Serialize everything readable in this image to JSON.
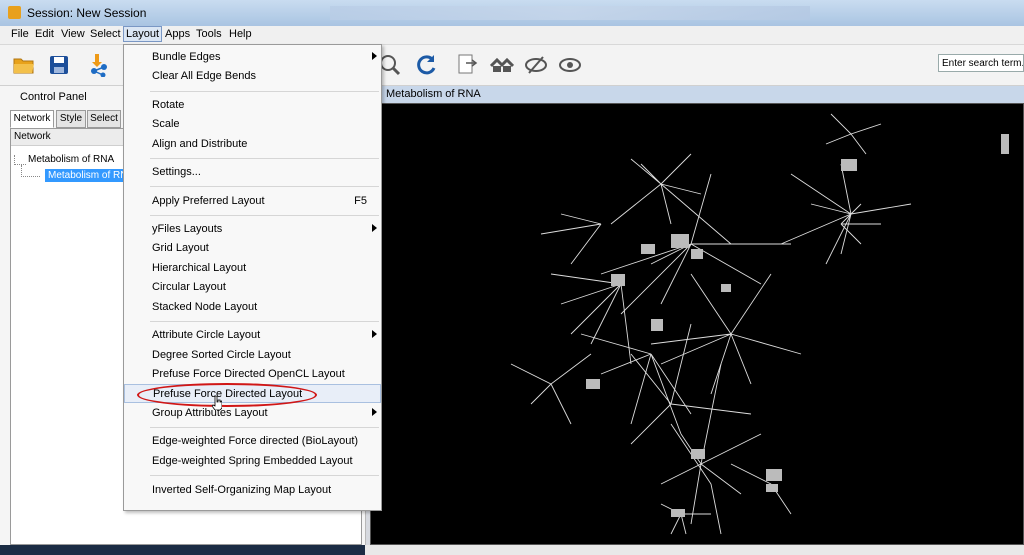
{
  "window": {
    "title": "Session: New Session"
  },
  "menubar": {
    "file": "File",
    "edit": "Edit",
    "view": "View",
    "select": "Select",
    "layout": "Layout",
    "apps": "Apps",
    "tools": "Tools",
    "help": "Help"
  },
  "toolbar": {
    "search_placeholder": "Enter search term...",
    "icons": [
      "open-folder-icon",
      "save-icon",
      "import-network-icon",
      "zoom-selected-icon",
      "refresh-icon",
      "export-image-icon",
      "home-icon",
      "hide-icon",
      "show-icon"
    ]
  },
  "control_panel": {
    "title": "Control Panel",
    "tabs": [
      "Network",
      "Style",
      "Select"
    ],
    "header": "Network",
    "tree": {
      "collection": "Metabolism of RNA",
      "network": "Metabolism of RNA"
    }
  },
  "network_view": {
    "title": "Metabolism of RNA"
  },
  "layout_menu": {
    "items": [
      {
        "label": "Bundle Edges",
        "submenu": true
      },
      {
        "label": "Clear All Edge Bends"
      },
      {
        "label": "Rotate"
      },
      {
        "label": "Scale"
      },
      {
        "label": "Align and Distribute"
      },
      {
        "label": "Settings..."
      },
      {
        "label": "Apply Preferred Layout",
        "accelerator": "F5"
      },
      {
        "label": "yFiles Layouts",
        "submenu": true
      },
      {
        "label": "Grid Layout"
      },
      {
        "label": "Hierarchical Layout"
      },
      {
        "label": "Circular Layout"
      },
      {
        "label": "Stacked Node Layout"
      },
      {
        "label": "Attribute Circle Layout",
        "submenu": true
      },
      {
        "label": "Degree Sorted Circle Layout"
      },
      {
        "label": "Prefuse Force Directed OpenCL Layout"
      },
      {
        "label": "Prefuse Force Directed Layout",
        "highlighted": true
      },
      {
        "label": "Group Attributes Layout",
        "submenu": true
      },
      {
        "label": "Edge-weighted Force directed (BioLayout)"
      },
      {
        "label": "Edge-weighted Spring Embedded Layout"
      },
      {
        "label": "Inverted Self-Organizing Map Layout"
      }
    ]
  },
  "colors": {
    "highlight_ellipse": "#d01616",
    "selection": "#3399ff",
    "canvas": "#000000"
  }
}
